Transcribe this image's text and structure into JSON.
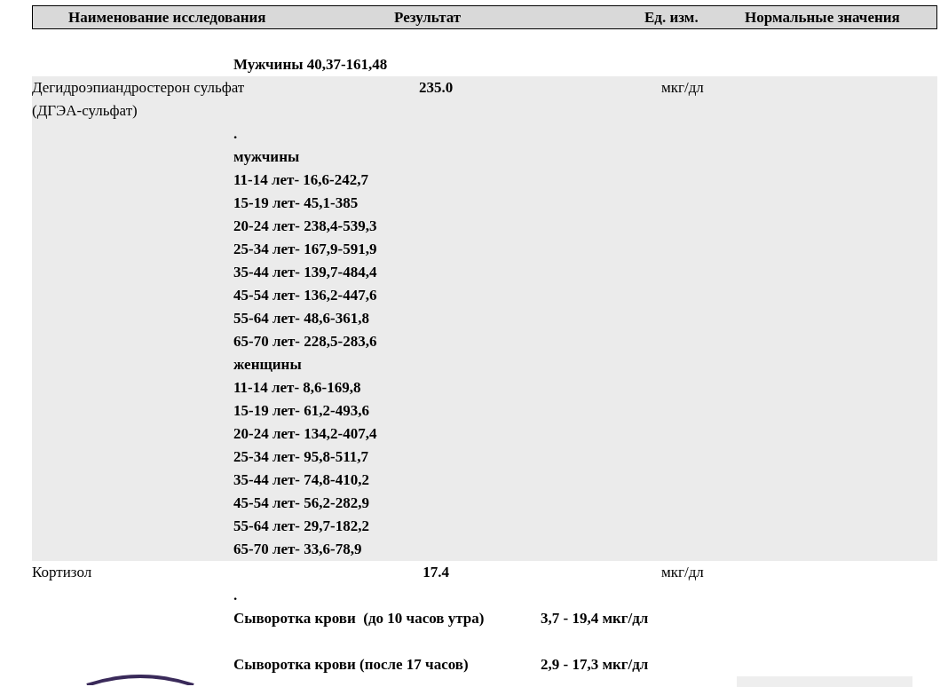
{
  "table": {
    "columns": [
      "Наименование исследования",
      "Результат",
      "Ед. изм.",
      "Нормальные значения"
    ],
    "continued_text": "Мужчины 40,37-161,48",
    "rows": [
      {
        "name": "Дегидроэпиандростерон сульфат (ДГЭА-сульфат)",
        "result": "235.0",
        "unit": "мкг/дл",
        "highlighted": true,
        "normal_values": [
          {
            "text": "."
          },
          {
            "text": "мужчины"
          },
          {
            "text": "11-14 лет- 16,6-242,7"
          },
          {
            "text": "15-19 лет- 45,1-385"
          },
          {
            "text": "20-24 лет- 238,4-539,3"
          },
          {
            "text": "25-34 лет- 167,9-591,9"
          },
          {
            "text": "35-44 лет- 139,7-484,4"
          },
          {
            "text": "45-54 лет- 136,2-447,6"
          },
          {
            "text": "55-64 лет- 48,6-361,8"
          },
          {
            "text": "65-70 лет- 228,5-283,6"
          },
          {
            "text": "женщины"
          },
          {
            "text": "11-14 лет- 8,6-169,8"
          },
          {
            "text": "15-19 лет- 61,2-493,6"
          },
          {
            "text": "20-24 лет- 134,2-407,4"
          },
          {
            "text": "25-34 лет- 95,8-511,7"
          },
          {
            "text": "35-44 лет- 74,8-410,2"
          },
          {
            "text": "45-54 лет- 56,2-282,9"
          },
          {
            "text": "55-64 лет- 29,7-182,2"
          },
          {
            "text": "65-70 лет- 33,6-78,9"
          }
        ]
      },
      {
        "name": "Кортизол",
        "result": "17.4",
        "unit": "мкг/дл",
        "highlighted": false,
        "normal_values": [
          {
            "text": "."
          },
          {
            "text": "Сыворотка крови  (до 10 часов утра)",
            "value": "3,7 - 19,4 мкг/дл"
          },
          {
            "text": "Сыворотка крови (после 17 часов)",
            "value": "2,9 - 17,3 мкг/дл"
          }
        ]
      }
    ]
  }
}
